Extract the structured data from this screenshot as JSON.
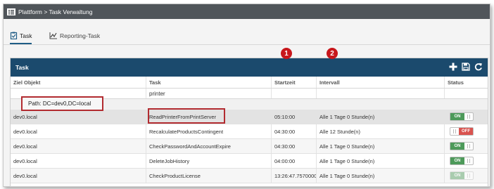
{
  "titlebar": {
    "breadcrumb": "Plattform > Task Verwaltung"
  },
  "tabs": [
    {
      "label": "Task",
      "active": true
    },
    {
      "label": "Reporting-Task",
      "active": false
    }
  ],
  "panel": {
    "title": "Task"
  },
  "toolbar": {
    "add_icon": "plus-icon",
    "save_icon": "save-icon",
    "refresh_icon": "refresh-icon"
  },
  "columns": [
    "Ziel Objekt",
    "Task",
    "Startzeit",
    "Intervall",
    "Status"
  ],
  "filter": {
    "task": "printer"
  },
  "group_path": "Path: DC=dev0,DC=local",
  "annotations": {
    "badge_1": "1",
    "badge_2": "2"
  },
  "rows": [
    {
      "ziel": "dev0.local",
      "task": "ReadPrinterFromPrintServer",
      "start": "05:10:00",
      "intervall": "Alle 1 Tage 0 Stunde(n)",
      "status_label": "ON",
      "status": "on"
    },
    {
      "ziel": "dev0.local",
      "task": "RecalculateProductsContingent",
      "start": "04:30:00",
      "intervall": "Alle 12 Stunde(n)",
      "status_label": "OFF",
      "status": "off"
    },
    {
      "ziel": "dev0.local",
      "task": "CheckPasswordAndAccountExpire",
      "start": "04:30:00",
      "intervall": "Alle 1 Tage 0 Stunde(n)",
      "status_label": "ON",
      "status": "on"
    },
    {
      "ziel": "dev0.local",
      "task": "DeleteJobHistory",
      "start": "04:00:00",
      "intervall": "Alle 1 Tage 0 Stunde(n)",
      "status_label": "ON",
      "status": "on"
    },
    {
      "ziel": "dev0.local",
      "task": "CheckProductLicense",
      "start": "13:26:47.7570000",
      "intervall": "Alle 1 Tage 0 Stunde(n)",
      "status_label": "ON",
      "status": "on"
    }
  ],
  "colors": {
    "titlebar": "#50555a",
    "panel_header": "#1b4a6d",
    "toggle_on": "#4d9a5a",
    "toggle_off": "#d9534f",
    "highlight": "#b22b30",
    "badge": "#c8171c"
  }
}
